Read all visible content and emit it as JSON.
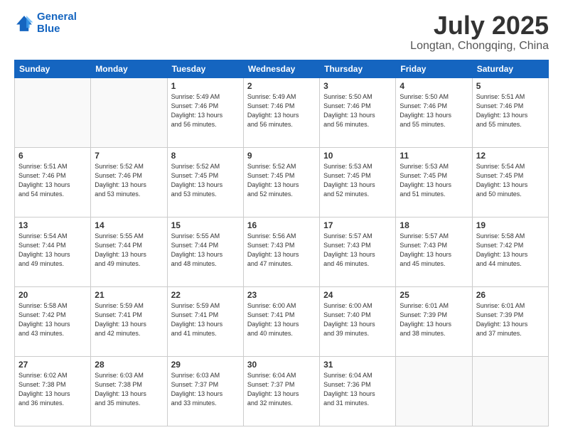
{
  "header": {
    "logo_line1": "General",
    "logo_line2": "Blue",
    "month": "July 2025",
    "location": "Longtan, Chongqing, China"
  },
  "weekdays": [
    "Sunday",
    "Monday",
    "Tuesday",
    "Wednesday",
    "Thursday",
    "Friday",
    "Saturday"
  ],
  "weeks": [
    [
      {
        "day": "",
        "info": ""
      },
      {
        "day": "",
        "info": ""
      },
      {
        "day": "1",
        "info": "Sunrise: 5:49 AM\nSunset: 7:46 PM\nDaylight: 13 hours\nand 56 minutes."
      },
      {
        "day": "2",
        "info": "Sunrise: 5:49 AM\nSunset: 7:46 PM\nDaylight: 13 hours\nand 56 minutes."
      },
      {
        "day": "3",
        "info": "Sunrise: 5:50 AM\nSunset: 7:46 PM\nDaylight: 13 hours\nand 56 minutes."
      },
      {
        "day": "4",
        "info": "Sunrise: 5:50 AM\nSunset: 7:46 PM\nDaylight: 13 hours\nand 55 minutes."
      },
      {
        "day": "5",
        "info": "Sunrise: 5:51 AM\nSunset: 7:46 PM\nDaylight: 13 hours\nand 55 minutes."
      }
    ],
    [
      {
        "day": "6",
        "info": "Sunrise: 5:51 AM\nSunset: 7:46 PM\nDaylight: 13 hours\nand 54 minutes."
      },
      {
        "day": "7",
        "info": "Sunrise: 5:52 AM\nSunset: 7:46 PM\nDaylight: 13 hours\nand 53 minutes."
      },
      {
        "day": "8",
        "info": "Sunrise: 5:52 AM\nSunset: 7:45 PM\nDaylight: 13 hours\nand 53 minutes."
      },
      {
        "day": "9",
        "info": "Sunrise: 5:52 AM\nSunset: 7:45 PM\nDaylight: 13 hours\nand 52 minutes."
      },
      {
        "day": "10",
        "info": "Sunrise: 5:53 AM\nSunset: 7:45 PM\nDaylight: 13 hours\nand 52 minutes."
      },
      {
        "day": "11",
        "info": "Sunrise: 5:53 AM\nSunset: 7:45 PM\nDaylight: 13 hours\nand 51 minutes."
      },
      {
        "day": "12",
        "info": "Sunrise: 5:54 AM\nSunset: 7:45 PM\nDaylight: 13 hours\nand 50 minutes."
      }
    ],
    [
      {
        "day": "13",
        "info": "Sunrise: 5:54 AM\nSunset: 7:44 PM\nDaylight: 13 hours\nand 49 minutes."
      },
      {
        "day": "14",
        "info": "Sunrise: 5:55 AM\nSunset: 7:44 PM\nDaylight: 13 hours\nand 49 minutes."
      },
      {
        "day": "15",
        "info": "Sunrise: 5:55 AM\nSunset: 7:44 PM\nDaylight: 13 hours\nand 48 minutes."
      },
      {
        "day": "16",
        "info": "Sunrise: 5:56 AM\nSunset: 7:43 PM\nDaylight: 13 hours\nand 47 minutes."
      },
      {
        "day": "17",
        "info": "Sunrise: 5:57 AM\nSunset: 7:43 PM\nDaylight: 13 hours\nand 46 minutes."
      },
      {
        "day": "18",
        "info": "Sunrise: 5:57 AM\nSunset: 7:43 PM\nDaylight: 13 hours\nand 45 minutes."
      },
      {
        "day": "19",
        "info": "Sunrise: 5:58 AM\nSunset: 7:42 PM\nDaylight: 13 hours\nand 44 minutes."
      }
    ],
    [
      {
        "day": "20",
        "info": "Sunrise: 5:58 AM\nSunset: 7:42 PM\nDaylight: 13 hours\nand 43 minutes."
      },
      {
        "day": "21",
        "info": "Sunrise: 5:59 AM\nSunset: 7:41 PM\nDaylight: 13 hours\nand 42 minutes."
      },
      {
        "day": "22",
        "info": "Sunrise: 5:59 AM\nSunset: 7:41 PM\nDaylight: 13 hours\nand 41 minutes."
      },
      {
        "day": "23",
        "info": "Sunrise: 6:00 AM\nSunset: 7:41 PM\nDaylight: 13 hours\nand 40 minutes."
      },
      {
        "day": "24",
        "info": "Sunrise: 6:00 AM\nSunset: 7:40 PM\nDaylight: 13 hours\nand 39 minutes."
      },
      {
        "day": "25",
        "info": "Sunrise: 6:01 AM\nSunset: 7:39 PM\nDaylight: 13 hours\nand 38 minutes."
      },
      {
        "day": "26",
        "info": "Sunrise: 6:01 AM\nSunset: 7:39 PM\nDaylight: 13 hours\nand 37 minutes."
      }
    ],
    [
      {
        "day": "27",
        "info": "Sunrise: 6:02 AM\nSunset: 7:38 PM\nDaylight: 13 hours\nand 36 minutes."
      },
      {
        "day": "28",
        "info": "Sunrise: 6:03 AM\nSunset: 7:38 PM\nDaylight: 13 hours\nand 35 minutes."
      },
      {
        "day": "29",
        "info": "Sunrise: 6:03 AM\nSunset: 7:37 PM\nDaylight: 13 hours\nand 33 minutes."
      },
      {
        "day": "30",
        "info": "Sunrise: 6:04 AM\nSunset: 7:37 PM\nDaylight: 13 hours\nand 32 minutes."
      },
      {
        "day": "31",
        "info": "Sunrise: 6:04 AM\nSunset: 7:36 PM\nDaylight: 13 hours\nand 31 minutes."
      },
      {
        "day": "",
        "info": ""
      },
      {
        "day": "",
        "info": ""
      }
    ]
  ]
}
